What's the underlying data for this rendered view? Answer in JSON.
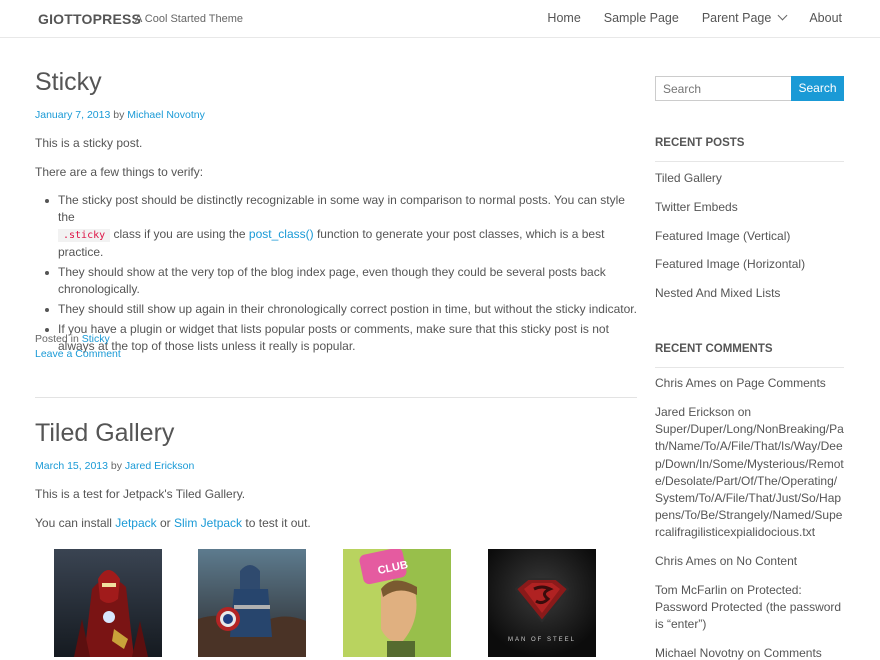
{
  "header": {
    "site_title": "GIOTTOPRESS",
    "site_description": "A Cool Started Theme",
    "nav": [
      {
        "label": "Home"
      },
      {
        "label": "Sample Page"
      },
      {
        "label": "Parent Page",
        "has_dropdown": true
      },
      {
        "label": "About"
      }
    ]
  },
  "posts": [
    {
      "title": "Sticky",
      "date": "January 7, 2013",
      "by": "by",
      "author": "Michael Novotny",
      "paragraphs": [
        "This is a sticky post.",
        "There are a few things to verify:"
      ],
      "list": [
        {
          "a": "The sticky post should be distinctly recognizable in some way in comparison to normal posts. You can style the",
          "code": ".sticky",
          "b": "class if you are using the",
          "link": "post_class()",
          "c": "function to generate your post classes, which is a best practice."
        },
        {
          "text": "They should show at the very top of the blog index page, even though they could be several posts back chronologically."
        },
        {
          "text": "They should still show up again in their chronologically correct postion in time, but without the sticky indicator."
        },
        {
          "text": "If you have a plugin or widget that lists popular posts or comments, make sure that this sticky post is not always at the top of those lists unless it really is popular."
        }
      ],
      "posted_in_label": "Posted in",
      "category": "Sticky",
      "comment_link": "Leave a Comment"
    },
    {
      "title": "Tiled Gallery",
      "date": "March 15, 2013",
      "by": "by",
      "author": "Jared Erickson",
      "paragraph": "This is a test for Jetpack's Tiled Gallery.",
      "install_a": "You can install",
      "link1": "Jetpack",
      "install_b": "or",
      "link2": "Slim Jetpack",
      "install_c": "to test it out.",
      "gallery": [
        {
          "name": "iron-man"
        },
        {
          "name": "captain-america"
        },
        {
          "name": "fight-club",
          "label": "CLUB"
        },
        {
          "name": "man-of-steel",
          "caption": "MAN OF STEEL"
        }
      ]
    }
  ],
  "sidebar": {
    "search_placeholder": "Search",
    "search_button": "Search",
    "recent_posts_title": "RECENT POSTS",
    "recent_posts": [
      "Tiled Gallery",
      "Twitter Embeds",
      "Featured Image (Vertical)",
      "Featured Image (Horizontal)",
      "Nested And Mixed Lists"
    ],
    "recent_comments_title": "RECENT COMMENTS",
    "recent_comments": [
      {
        "author": "Chris Ames",
        "on": "on",
        "post": "Page Comments"
      },
      {
        "author": "Jared Erickson",
        "on": "on",
        "post": "Super/Duper/Long/NonBreaking/Path/Name/To/A/File/That/Is/Way/Deep/Down/In/Some/Mysterious/Remote/Desolate/Part/Of/The/Operating/System/To/A/File/That/Just/So/Happens/To/Be/Strangely/Named/Supercalifragilisticexpialidocious.txt"
      },
      {
        "author": "Chris Ames",
        "on": "on",
        "post": "No Content"
      },
      {
        "author": "Tom McFarlin",
        "on": "on",
        "post": "Protected: Password Protected (the password is “enter”)"
      },
      {
        "author": "Michael Novotny",
        "on": "on",
        "post": "Comments"
      }
    ]
  }
}
